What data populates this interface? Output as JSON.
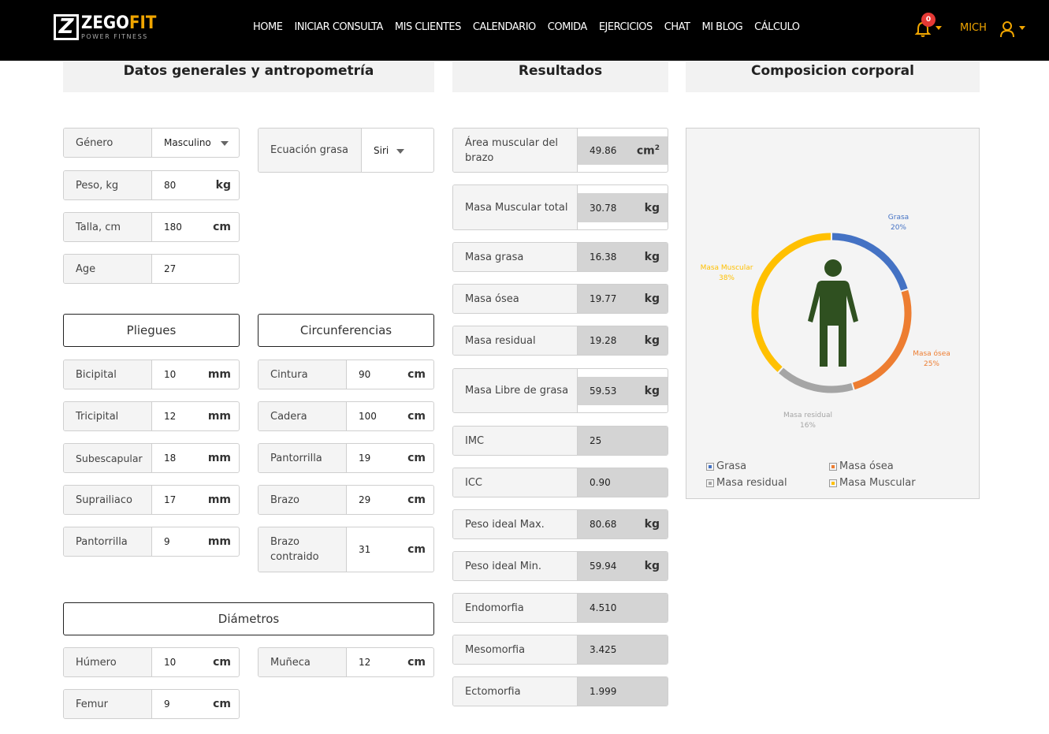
{
  "brand": {
    "initial": "Z",
    "name_a": "ZEGO",
    "name_b": "FIT",
    "subtitle": "POWER FITNESS"
  },
  "nav": {
    "items": [
      "HOME",
      "INICIAR CONSULTA",
      "MIS CLIENTES",
      "CALENDARIO",
      "COMIDA",
      "EJERCICIOS",
      "CHAT",
      "MI BLOG",
      "CÁLCULO"
    ],
    "notifications": "0",
    "user": "MICH"
  },
  "sections": {
    "general": "Datos generales y antropometría",
    "results": "Resultados",
    "composition": "Composicion corporal"
  },
  "general": {
    "genero": {
      "label": "Género",
      "value": "Masculino"
    },
    "ecuacion": {
      "label": "Ecuación grasa",
      "value": "Siri"
    },
    "peso": {
      "label": "Peso, kg",
      "value": "80",
      "unit": "kg"
    },
    "talla": {
      "label": "Talla, cm",
      "value": "180",
      "unit": "cm"
    },
    "age": {
      "label": "Age",
      "value": "27"
    }
  },
  "pliegues": {
    "title": "Pliegues",
    "items": [
      {
        "label": "Bicipital",
        "value": "10",
        "unit": "mm"
      },
      {
        "label": "Tricipital",
        "value": "12",
        "unit": "mm"
      },
      {
        "label": "Subescapular",
        "value": "18",
        "unit": "mm"
      },
      {
        "label": "Suprailiaco",
        "value": "17",
        "unit": "mm"
      },
      {
        "label": "Pantorrilla",
        "value": "9",
        "unit": "mm"
      }
    ]
  },
  "circunferencias": {
    "title": "Circunferencias",
    "items": [
      {
        "label": "Cintura",
        "value": "90",
        "unit": "cm"
      },
      {
        "label": "Cadera",
        "value": "100",
        "unit": "cm"
      },
      {
        "label": "Pantorrilla",
        "value": "19",
        "unit": "cm"
      },
      {
        "label": "Brazo",
        "value": "29",
        "unit": "cm"
      },
      {
        "label": "Brazo contraido",
        "value": "31",
        "unit": "cm"
      }
    ]
  },
  "diametros": {
    "title": "Diámetros",
    "items": [
      {
        "label": "Húmero",
        "value": "10",
        "unit": "cm"
      },
      {
        "label": "Muñeca",
        "value": "12",
        "unit": "cm"
      },
      {
        "label": "Femur",
        "value": "9",
        "unit": "cm"
      }
    ]
  },
  "results": [
    {
      "label": "Área muscular del brazo",
      "value": "49.86",
      "unit": "cm",
      "sup": "2"
    },
    {
      "label": "Masa Muscular total",
      "value": "30.78",
      "unit": "kg"
    },
    {
      "label": "Masa grasa",
      "value": "16.38",
      "unit": "kg"
    },
    {
      "label": "Masa ósea",
      "value": "19.77",
      "unit": "kg"
    },
    {
      "label": "Masa residual",
      "value": "19.28",
      "unit": "kg"
    },
    {
      "label": "Masa Libre de grasa",
      "value": "59.53",
      "unit": "kg"
    },
    {
      "label": "IMC",
      "value": "25",
      "unit": ""
    },
    {
      "label": "ICC",
      "value": "0.90",
      "unit": ""
    },
    {
      "label": "Peso ideal Max.",
      "value": "80.68",
      "unit": "kg"
    },
    {
      "label": "Peso ideal Min.",
      "value": "59.94",
      "unit": "kg"
    },
    {
      "label": "Endomorfia",
      "value": "4.510",
      "unit": ""
    },
    {
      "label": "Mesomorfia",
      "value": "3.425",
      "unit": ""
    },
    {
      "label": "Ectomorfia",
      "value": "1.999",
      "unit": ""
    }
  ],
  "chart_data": {
    "type": "pie",
    "categories": [
      "Grasa",
      "Masa ósea",
      "Masa residual",
      "Masa Muscular"
    ],
    "values": [
      20,
      25,
      16,
      38
    ],
    "value_labels": [
      "20%",
      "25%",
      "16%",
      "38%"
    ],
    "colors": [
      "#4472c4",
      "#ed7d31",
      "#a5a5a5",
      "#ffc000"
    ],
    "legend": "bottom"
  }
}
